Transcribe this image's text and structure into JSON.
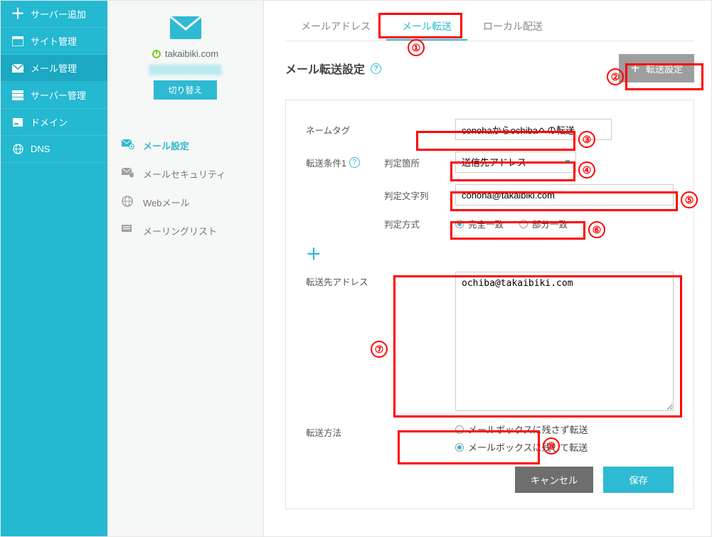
{
  "nav": {
    "items": [
      {
        "id": "add",
        "label": "サーバー追加",
        "icon": "plus-icon"
      },
      {
        "id": "site",
        "label": "サイト管理",
        "icon": "window-icon"
      },
      {
        "id": "mail",
        "label": "メール管理",
        "icon": "envelope-icon",
        "active": true
      },
      {
        "id": "server",
        "label": "サーバー管理",
        "icon": "servers-icon"
      },
      {
        "id": "domain",
        "label": "ドメイン",
        "icon": "tile-icon"
      },
      {
        "id": "dns",
        "label": "DNS",
        "icon": "globe-icon"
      }
    ]
  },
  "site": {
    "domain": "takaibiki.com",
    "switch_label": "切り替え"
  },
  "submenu": {
    "items": [
      {
        "id": "mail-settings",
        "label": "メール設定",
        "active": true
      },
      {
        "id": "mail-security",
        "label": "メールセキュリティ"
      },
      {
        "id": "webmail",
        "label": "Webメール"
      },
      {
        "id": "mailing-list",
        "label": "メーリングリスト"
      }
    ]
  },
  "tabs": {
    "items": [
      {
        "id": "address",
        "label": "メールアドレス"
      },
      {
        "id": "forward",
        "label": "メール転送",
        "active": true
      },
      {
        "id": "local",
        "label": "ローカル配送"
      }
    ]
  },
  "header": {
    "title": "メール転送設定",
    "add_label": "転送設定"
  },
  "form": {
    "name_tag_label": "ネームタグ",
    "name_tag_value": "conohaからochibaへの転送",
    "cond_label": "転送条件1",
    "judge_loc_label": "判定箇所",
    "judge_loc_value": "送信先アドレス",
    "judge_str_label": "判定文字列",
    "judge_str_value": "conoha@takaibiki.com",
    "judge_mode_label": "判定方式",
    "judge_mode_exact": "完全一致",
    "judge_mode_part": "部分一致",
    "fwd_addr_label": "転送先アドレス",
    "fwd_addr_value": "ochiba@takaibiki.com",
    "fwd_method_label": "転送方法",
    "fwd_method_opt1": "メールボックスに残さず転送",
    "fwd_method_opt2": "メールボックスに残して転送",
    "cancel_label": "キャンセル",
    "save_label": "保存"
  },
  "annotations": [
    "①",
    "②",
    "③",
    "④",
    "⑤",
    "⑥",
    "⑦",
    "⑧"
  ]
}
